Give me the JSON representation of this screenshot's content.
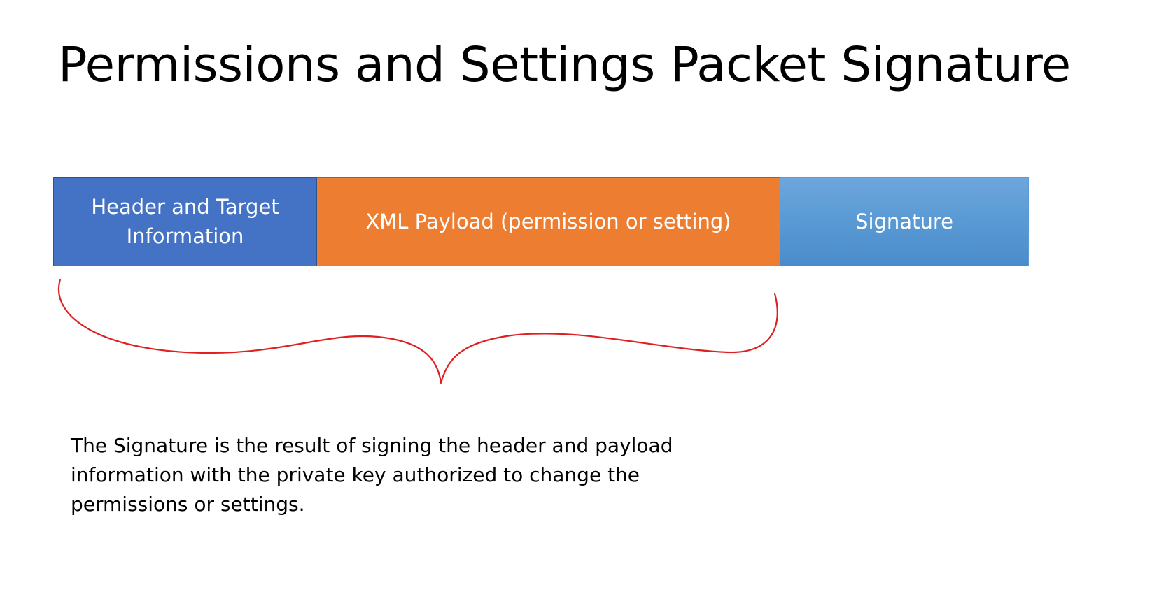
{
  "title": "Permissions and Settings Packet Signature",
  "packet": {
    "segments": [
      {
        "label_line1": "Header and Target",
        "label_line2": "Information",
        "color": "#4472c4"
      },
      {
        "label": "XML Payload (permission or setting)",
        "color": "#ed7d31"
      },
      {
        "label": "Signature",
        "color": "#5b9bd5"
      }
    ]
  },
  "brace": {
    "color": "#e02020",
    "icon": "curly-brace-annotation"
  },
  "caption": {
    "line1": "The Signature is the result of signing the header and payload",
    "line2": "information with the private key authorized to change the",
    "line3": "permissions or settings."
  }
}
